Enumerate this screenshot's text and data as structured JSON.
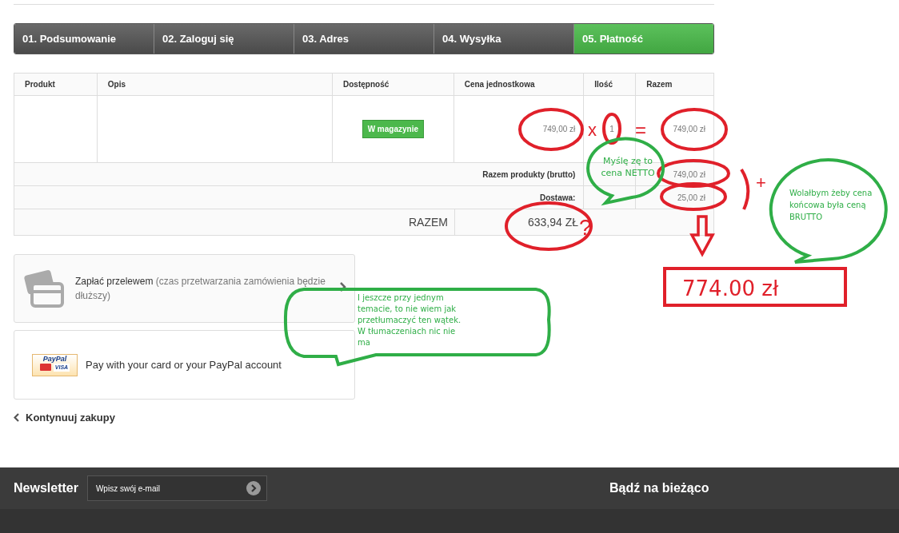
{
  "steps": [
    {
      "label": "01. Podsumowanie",
      "selected": false
    },
    {
      "label": "02. Zaloguj się",
      "selected": false
    },
    {
      "label": "03. Adres",
      "selected": false
    },
    {
      "label": "04. Wysyłka",
      "selected": false
    },
    {
      "label": "05. Płatność",
      "selected": true
    }
  ],
  "cart": {
    "columns": [
      "Produkt",
      "Opis",
      "Dostępność",
      "Cena jednostkowa",
      "Ilość",
      "Razem"
    ],
    "item": {
      "availability": "W magazynie",
      "unit_price": "749,00 zł",
      "quantity": "1",
      "total": "749,00 zł"
    },
    "summary": [
      {
        "label": "Razem produkty (brutto)",
        "value": "749,00 zł"
      },
      {
        "label": "Dostawa:",
        "value": "25,00 zł"
      }
    ],
    "grand_total": {
      "label": "RAZEM",
      "value": "633,94 ZŁ"
    }
  },
  "payment_options": [
    {
      "kind": "transfer",
      "title": "Zapłać przelewem",
      "note": "(czas przetwarzania zamówienia będzie dłuższy)"
    },
    {
      "kind": "paypal",
      "logo": "PayPal",
      "card": "VISA",
      "text": "Pay with your card or your PayPal account"
    }
  ],
  "continue_link": "Kontynuuj zakupy",
  "footer": {
    "newsletter": "Newsletter",
    "placeholder": "Wpisz swój e-mail",
    "heading": "Bądź na bieżąco"
  },
  "annotations": {
    "times": "x",
    "equals": "=",
    "plus": "+",
    "question": "?",
    "result": "774.00 zł",
    "bubbles": [
      "Myślę zę to cena NETTO",
      "Wolałbym  żeby cena końcowa była ceną BRUTTO",
      "I jeszcze przy jednym temacie, to nie wiem jak przetłumaczyć ten wątek. W tłumaczeniach nic nie ma"
    ]
  }
}
